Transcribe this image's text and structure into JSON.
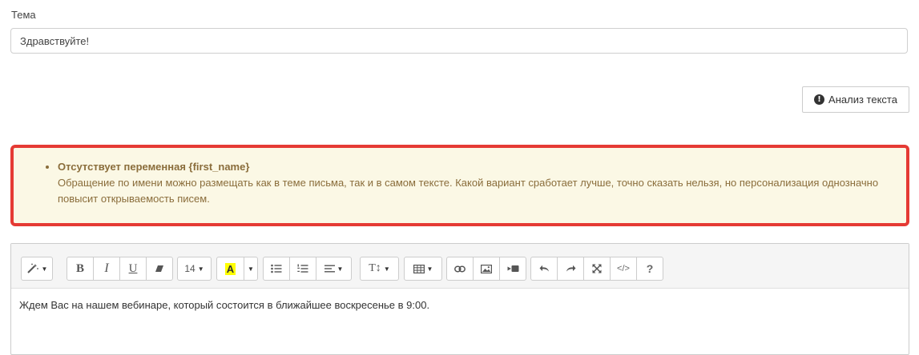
{
  "subject": {
    "label": "Тема",
    "value": "Здравствуйте!"
  },
  "analyze_button": {
    "label": "Анализ текста",
    "icon": "info-circle-icon"
  },
  "warning": {
    "title": "Отсутствует переменная {first_name}",
    "text": "Обращение по имени можно размещать как в теме письма, так и в самом тексте. Какой вариант сработает лучше, точно сказать нельзя, но персонализация однозначно повысит открываемость писем.",
    "border_color": "#e53a34",
    "background": "#fbf8e5"
  },
  "toolbar": {
    "font_size": "14",
    "bold": "B",
    "italic": "I",
    "underline": "U",
    "highlight_letter": "A",
    "text_style": "T↕",
    "help": "?",
    "code": "</>",
    "icons": [
      "magic-wand-icon",
      "bold-icon",
      "italic-icon",
      "underline-icon",
      "eraser-icon",
      "font-size-dropdown",
      "highlight-color-icon",
      "unordered-list-icon",
      "ordered-list-icon",
      "align-icon",
      "line-height-icon",
      "table-icon",
      "link-icon",
      "image-icon",
      "video-icon",
      "undo-icon",
      "redo-icon",
      "fullscreen-icon",
      "code-view-icon",
      "help-icon"
    ]
  },
  "editor": {
    "content": "Ждем Вас на нашем вебинаре, который состоится в ближайшее воскресенье в 9:00."
  }
}
